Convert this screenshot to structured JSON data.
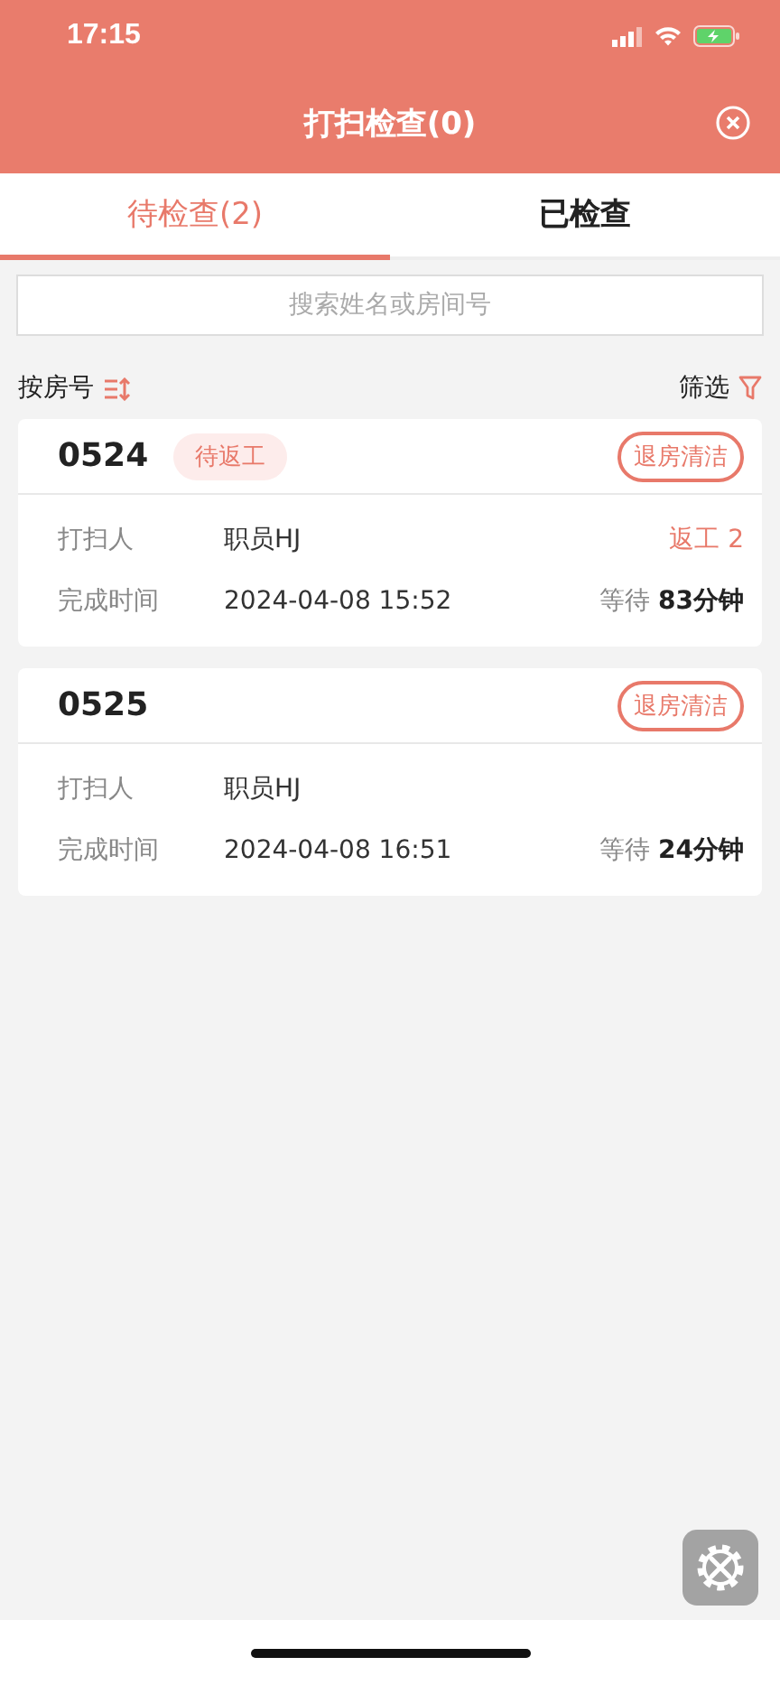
{
  "status_bar": {
    "time": "17:15"
  },
  "header": {
    "title": "打扫检查(0)"
  },
  "tabs": [
    {
      "label": "待检查(2)",
      "selected": true
    },
    {
      "label": "已检查",
      "selected": false
    }
  ],
  "search": {
    "placeholder": "搜索姓名或房间号"
  },
  "toolbar": {
    "sort_label": "按房号",
    "filter_label": "筛选"
  },
  "rooms": [
    {
      "number": "0524",
      "tag": "待返工",
      "type": "退房清洁",
      "cleaner_label": "打扫人",
      "cleaner": "职员HJ",
      "rework": "返工 2",
      "time_label": "完成时间",
      "time": "2024-04-08 15:52",
      "wait": "等待 **83分钟**"
    },
    {
      "number": "0525",
      "type": "退房清洁",
      "cleaner_label": "打扫人",
      "cleaner": "职员HJ",
      "time_label": "完成时间",
      "time": "2024-04-08 16:51",
      "wait": "等待 **24分钟**"
    }
  ]
}
